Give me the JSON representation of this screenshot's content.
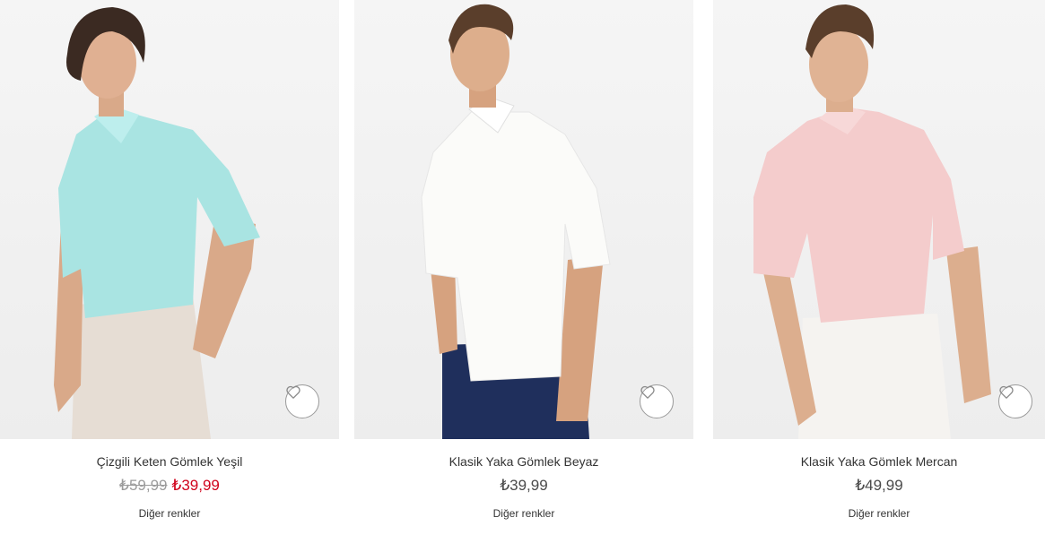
{
  "products": [
    {
      "name": "Çizgili Keten Gömlek Yeşil",
      "old_price": "₺59,99",
      "price": "₺39,99",
      "other_colors": "Diğer renkler",
      "shirt_color": "#a9e4e2"
    },
    {
      "name": "Klasik Yaka Gömlek Beyaz",
      "price": "₺39,99",
      "other_colors": "Diğer renkler",
      "shirt_color": "#fbfbf9"
    },
    {
      "name": "Klasik Yaka Gömlek Mercan",
      "price": "₺49,99",
      "other_colors": "Diğer renkler",
      "shirt_color": "#f4cccc"
    }
  ],
  "icons": {
    "favorite": "heart-icon"
  },
  "colors": {
    "sale": "#d0021b",
    "old_price": "#9b9b9b"
  }
}
